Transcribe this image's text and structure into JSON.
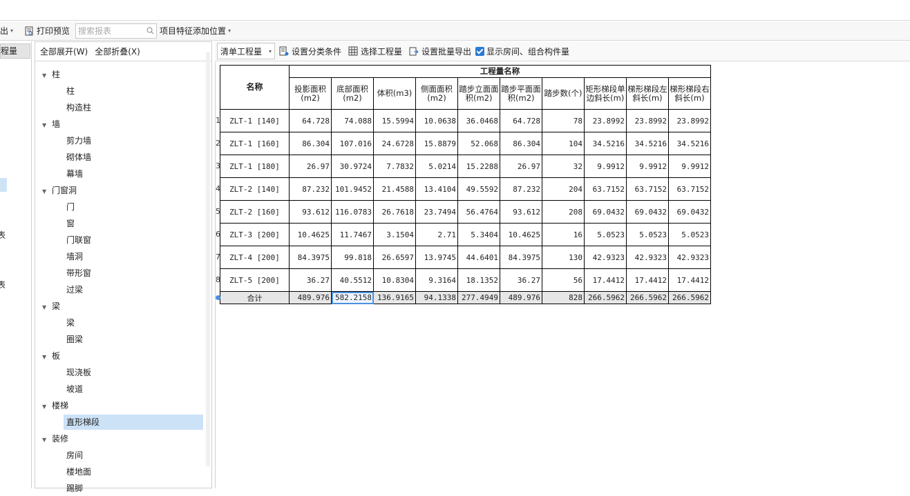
{
  "toolbar": {
    "export_label": "导出",
    "print_preview_label": "打印预览",
    "search_placeholder": "搜索报表",
    "feature_position_label": "项目特征添加位置"
  },
  "left_strip": {
    "tab_label": "程量",
    "chars": [
      "表",
      "表"
    ]
  },
  "tree": {
    "expand_all": "全部展开(W)",
    "collapse_all": "全部折叠(X)",
    "groups": [
      {
        "label": "柱",
        "items": [
          "柱",
          "构造柱"
        ]
      },
      {
        "label": "墙",
        "items": [
          "剪力墙",
          "砌体墙",
          "幕墙"
        ]
      },
      {
        "label": "门窗洞",
        "items": [
          "门",
          "窗",
          "门联窗",
          "墙洞",
          "带形窗",
          "过梁"
        ]
      },
      {
        "label": "梁",
        "items": [
          "梁",
          "圈梁"
        ]
      },
      {
        "label": "板",
        "items": [
          "现浇板",
          "坡道"
        ]
      },
      {
        "label": "楼梯",
        "items": [
          "直形梯段"
        ]
      },
      {
        "label": "装修",
        "items": [
          "房间",
          "楼地面",
          "踢脚"
        ]
      }
    ],
    "selected": "直形梯段"
  },
  "right_toolbar": {
    "combo_value": "清单工程量",
    "set_category": "设置分类条件",
    "select_quantity": "选择工程量",
    "set_batch_export": "设置批量导出",
    "show_room_label": "显示房间、组合构件量",
    "show_room_checked": true
  },
  "table": {
    "group_header": "工程量名称",
    "name_header": "名称",
    "columns": [
      "投影面积(m2)",
      "底部面积(m2)",
      "体积(m3)",
      "侧面面积(m2)",
      "踏步立面面积(m2)",
      "踏步平面面积(m2)",
      "踏步数(个)",
      "矩形梯段单边斜长(m)",
      "梯形梯段左斜长(m)",
      "梯形梯段右斜长(m)"
    ],
    "rows": [
      {
        "num": "1",
        "name": "ZLT-1 [140]",
        "values": [
          "64.728",
          "74.088",
          "15.5994",
          "10.0638",
          "36.0468",
          "64.728",
          "78",
          "23.8992",
          "23.8992",
          "23.8992"
        ]
      },
      {
        "num": "2",
        "name": "ZLT-1 [160]",
        "values": [
          "86.304",
          "107.016",
          "24.6728",
          "15.8879",
          "52.068",
          "86.304",
          "104",
          "34.5216",
          "34.5216",
          "34.5216"
        ]
      },
      {
        "num": "3",
        "name": "ZLT-1 [180]",
        "values": [
          "26.97",
          "30.9724",
          "7.7832",
          "5.0214",
          "15.2288",
          "26.97",
          "32",
          "9.9912",
          "9.9912",
          "9.9912"
        ]
      },
      {
        "num": "4",
        "name": "ZLT-2 [140]",
        "values": [
          "87.232",
          "101.9452",
          "21.4588",
          "13.4104",
          "49.5592",
          "87.232",
          "204",
          "63.7152",
          "63.7152",
          "63.7152"
        ]
      },
      {
        "num": "5",
        "name": "ZLT-2 [160]",
        "values": [
          "93.612",
          "116.0783",
          "26.7618",
          "23.7494",
          "56.4764",
          "93.612",
          "208",
          "69.0432",
          "69.0432",
          "69.0432"
        ]
      },
      {
        "num": "6",
        "name": "ZLT-3 [200]",
        "values": [
          "10.4625",
          "11.7467",
          "3.1504",
          "2.71",
          "5.3404",
          "10.4625",
          "16",
          "5.0523",
          "5.0523",
          "5.0523"
        ]
      },
      {
        "num": "7",
        "name": "ZLT-4 [200]",
        "values": [
          "84.3975",
          "99.818",
          "26.6597",
          "13.9745",
          "44.6401",
          "84.3975",
          "130",
          "42.9323",
          "42.9323",
          "42.9323"
        ]
      },
      {
        "num": "8",
        "name": "ZLT-5 [200]",
        "values": [
          "36.27",
          "40.5512",
          "10.8304",
          "9.3164",
          "18.1352",
          "36.27",
          "56",
          "17.4412",
          "17.4412",
          "17.4412"
        ]
      }
    ],
    "total": {
      "name": "合计",
      "values": [
        "489.976",
        "582.2158",
        "136.9165",
        "94.1338",
        "277.4949",
        "489.976",
        "828",
        "266.5962",
        "266.5962",
        "266.5962"
      ]
    }
  }
}
